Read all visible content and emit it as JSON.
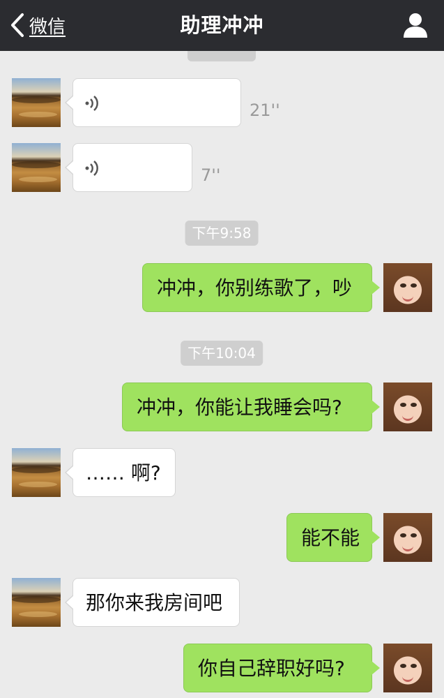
{
  "header": {
    "back_label": "微信",
    "title": "助理冲冲",
    "icons": {
      "back": "chevron-left-icon",
      "profile": "person-icon"
    }
  },
  "timestamps": [
    "下午9:58",
    "下午10:04"
  ],
  "messages": [
    {
      "side": "in",
      "type": "voice",
      "duration": "21''"
    },
    {
      "side": "in",
      "type": "voice",
      "duration": "7''"
    },
    {
      "side": "out",
      "type": "text",
      "text": "冲冲，你别练歌了，吵"
    },
    {
      "side": "out",
      "type": "text",
      "text": "冲冲，你能让我睡会吗?"
    },
    {
      "side": "in",
      "type": "text",
      "text": "…… 啊?"
    },
    {
      "side": "out",
      "type": "text",
      "text": "能不能"
    },
    {
      "side": "in",
      "type": "text",
      "text": "那你来我房间吧"
    },
    {
      "side": "out",
      "type": "text",
      "text": "你自己辞职好吗?"
    }
  ],
  "colors": {
    "nav_background": "#2b2c30",
    "chat_background": "#ebebeb",
    "outgoing_bubble": "#9fe25f",
    "incoming_bubble": "#ffffff",
    "timestamp_background": "#cfcfcf"
  }
}
